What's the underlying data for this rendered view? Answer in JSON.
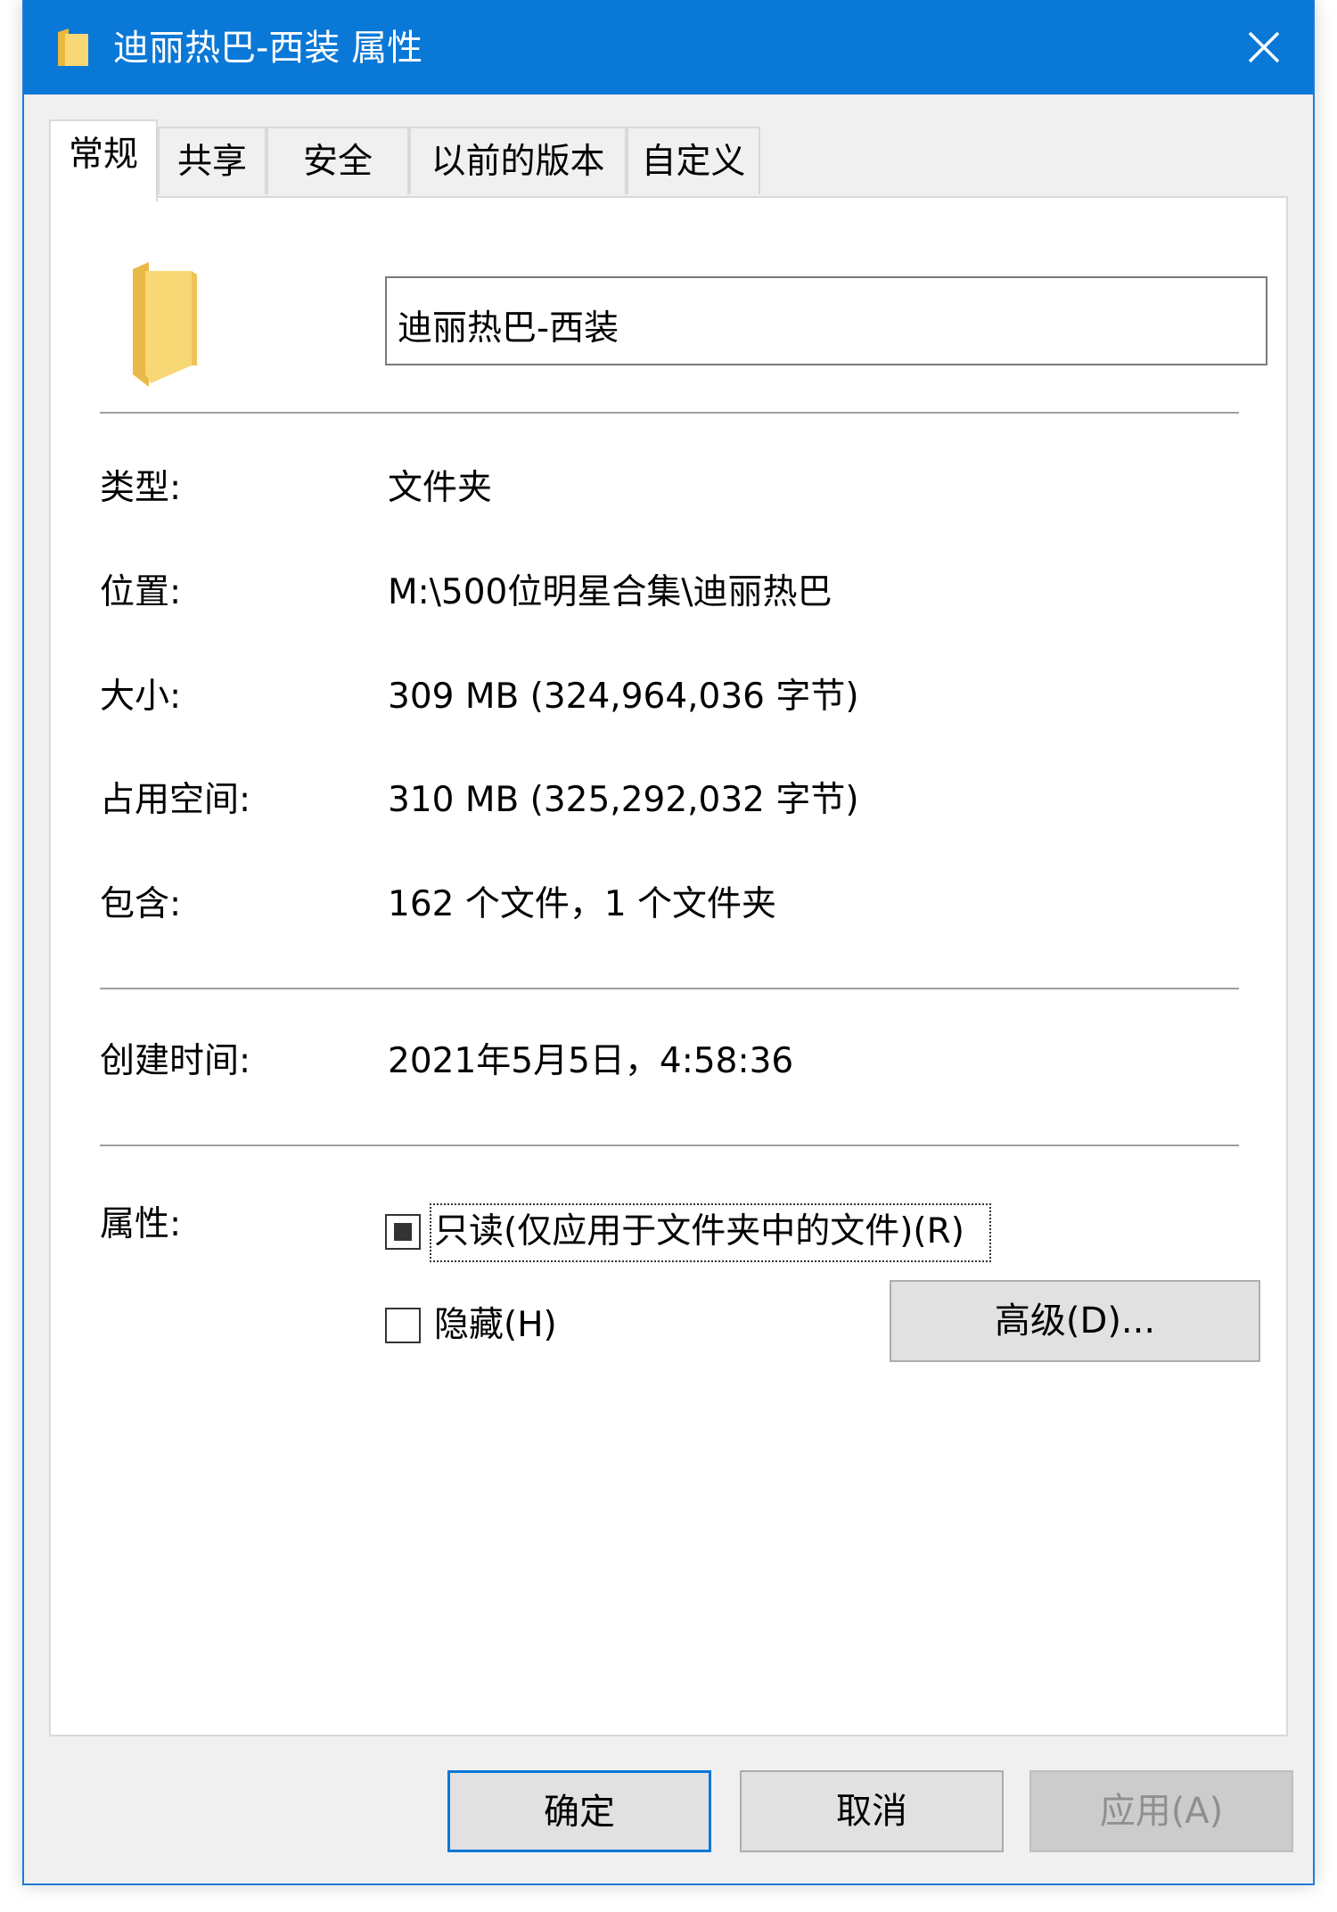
{
  "window": {
    "title": "迪丽热巴-西装 属性",
    "close_icon": "close-icon"
  },
  "tabs": [
    {
      "label": "常规",
      "active": true
    },
    {
      "label": "共享",
      "active": false
    },
    {
      "label": "安全",
      "active": false
    },
    {
      "label": "以前的版本",
      "active": false
    },
    {
      "label": "自定义",
      "active": false
    }
  ],
  "general": {
    "folder_name": "迪丽热巴-西装",
    "type_label": "类型:",
    "type_value": "文件夹",
    "location_label": "位置:",
    "location_value": "M:\\500位明星合集\\迪丽热巴",
    "size_label": "大小:",
    "size_value": "309 MB (324,964,036 字节)",
    "disk_label": "占用空间:",
    "disk_value": "310 MB (325,292,032 字节)",
    "contains_label": "包含:",
    "contains_value": "162 个文件，1 个文件夹",
    "created_label": "创建时间:",
    "created_value": "2021年5月5日，4:58:36",
    "attributes_label": "属性:",
    "readonly_label": "只读(仅应用于文件夹中的文件)(R)",
    "readonly_state": "indeterminate",
    "hidden_label": "隐藏(H)",
    "hidden_checked": false,
    "advanced_button": "高级(D)..."
  },
  "footer": {
    "ok_button": "确定",
    "cancel_button": "取消",
    "apply_button": "应用(A)"
  },
  "colors": {
    "titlebar": "#0a78d7",
    "folder": "#f5d77a"
  }
}
